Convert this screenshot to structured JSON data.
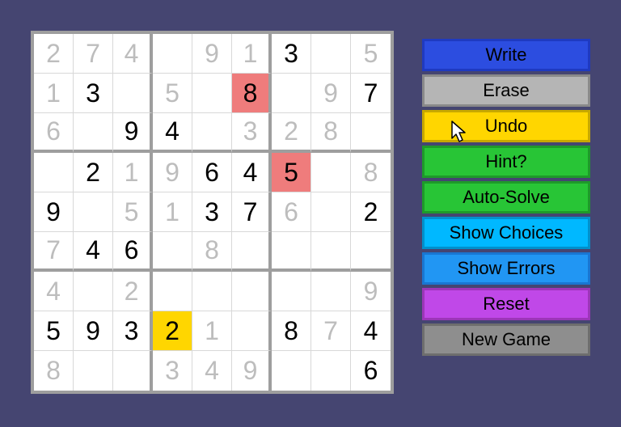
{
  "board": {
    "rows": [
      [
        {
          "v": "2",
          "t": "hint"
        },
        {
          "v": "7",
          "t": "hint"
        },
        {
          "v": "4",
          "t": "hint"
        },
        {
          "v": "",
          "t": "hint"
        },
        {
          "v": "9",
          "t": "hint"
        },
        {
          "v": "1",
          "t": "hint"
        },
        {
          "v": "3",
          "t": "bold"
        },
        {
          "v": "",
          "t": "hint"
        },
        {
          "v": "5",
          "t": "hint"
        }
      ],
      [
        {
          "v": "1",
          "t": "hint"
        },
        {
          "v": "3",
          "t": "bold"
        },
        {
          "v": "",
          "t": "hint"
        },
        {
          "v": "5",
          "t": "hint"
        },
        {
          "v": "",
          "t": "hint"
        },
        {
          "v": "8",
          "t": "bold",
          "hl": "red"
        },
        {
          "v": "",
          "t": "hint"
        },
        {
          "v": "9",
          "t": "hint"
        },
        {
          "v": "7",
          "t": "bold"
        }
      ],
      [
        {
          "v": "6",
          "t": "hint"
        },
        {
          "v": "",
          "t": "hint"
        },
        {
          "v": "9",
          "t": "bold"
        },
        {
          "v": "4",
          "t": "bold"
        },
        {
          "v": "",
          "t": "hint"
        },
        {
          "v": "3",
          "t": "hint"
        },
        {
          "v": "2",
          "t": "hint"
        },
        {
          "v": "8",
          "t": "hint"
        },
        {
          "v": "",
          "t": "hint"
        }
      ],
      [
        {
          "v": "",
          "t": "hint"
        },
        {
          "v": "2",
          "t": "bold"
        },
        {
          "v": "1",
          "t": "hint"
        },
        {
          "v": "9",
          "t": "hint"
        },
        {
          "v": "6",
          "t": "bold"
        },
        {
          "v": "4",
          "t": "bold"
        },
        {
          "v": "5",
          "t": "bold",
          "hl": "red"
        },
        {
          "v": "",
          "t": "hint"
        },
        {
          "v": "8",
          "t": "hint"
        }
      ],
      [
        {
          "v": "9",
          "t": "bold"
        },
        {
          "v": "",
          "t": "hint"
        },
        {
          "v": "5",
          "t": "hint"
        },
        {
          "v": "1",
          "t": "hint"
        },
        {
          "v": "3",
          "t": "bold"
        },
        {
          "v": "7",
          "t": "bold"
        },
        {
          "v": "6",
          "t": "hint"
        },
        {
          "v": "",
          "t": "hint"
        },
        {
          "v": "2",
          "t": "bold"
        }
      ],
      [
        {
          "v": "7",
          "t": "hint"
        },
        {
          "v": "4",
          "t": "bold"
        },
        {
          "v": "6",
          "t": "bold"
        },
        {
          "v": "",
          "t": "hint"
        },
        {
          "v": "8",
          "t": "hint"
        },
        {
          "v": "",
          "t": "hint"
        },
        {
          "v": "",
          "t": "hint"
        },
        {
          "v": "",
          "t": "hint"
        },
        {
          "v": "",
          "t": "hint"
        }
      ],
      [
        {
          "v": "4",
          "t": "hint"
        },
        {
          "v": "",
          "t": "hint"
        },
        {
          "v": "2",
          "t": "hint"
        },
        {
          "v": "",
          "t": "hint"
        },
        {
          "v": "",
          "t": "hint"
        },
        {
          "v": "",
          "t": "hint"
        },
        {
          "v": "",
          "t": "hint"
        },
        {
          "v": "",
          "t": "hint"
        },
        {
          "v": "9",
          "t": "hint"
        }
      ],
      [
        {
          "v": "5",
          "t": "bold"
        },
        {
          "v": "9",
          "t": "bold"
        },
        {
          "v": "3",
          "t": "bold"
        },
        {
          "v": "2",
          "t": "bold",
          "hl": "yellow"
        },
        {
          "v": "1",
          "t": "hint"
        },
        {
          "v": "",
          "t": "hint"
        },
        {
          "v": "8",
          "t": "bold"
        },
        {
          "v": "7",
          "t": "hint"
        },
        {
          "v": "4",
          "t": "bold"
        }
      ],
      [
        {
          "v": "8",
          "t": "hint"
        },
        {
          "v": "",
          "t": "hint"
        },
        {
          "v": "",
          "t": "hint"
        },
        {
          "v": "3",
          "t": "hint"
        },
        {
          "v": "4",
          "t": "hint"
        },
        {
          "v": "9",
          "t": "hint"
        },
        {
          "v": "",
          "t": "hint"
        },
        {
          "v": "",
          "t": "hint"
        },
        {
          "v": "6",
          "t": "bold"
        }
      ]
    ]
  },
  "buttons": [
    {
      "id": "write",
      "label": "Write",
      "bg": "#2c4de0",
      "border": "#1f3ac0"
    },
    {
      "id": "erase",
      "label": "Erase",
      "bg": "#b5b5b5",
      "border": "#8a8a8a"
    },
    {
      "id": "undo",
      "label": "Undo",
      "bg": "#ffd600",
      "border": "#c7a800"
    },
    {
      "id": "hint",
      "label": "Hint?",
      "bg": "#28c536",
      "border": "#1e9a2a"
    },
    {
      "id": "autosolve",
      "label": "Auto-Solve",
      "bg": "#28c536",
      "border": "#1e9a2a"
    },
    {
      "id": "showchoices",
      "label": "Show Choices",
      "bg": "#00b8ff",
      "border": "#0090cc"
    },
    {
      "id": "showerrors",
      "label": "Show Errors",
      "bg": "#2196f3",
      "border": "#1976d2"
    },
    {
      "id": "reset",
      "label": "Reset",
      "bg": "#c048e8",
      "border": "#9c36b8"
    },
    {
      "id": "newgame",
      "label": "New Game",
      "bg": "#8e8e8e",
      "border": "#6e6e6e"
    }
  ]
}
